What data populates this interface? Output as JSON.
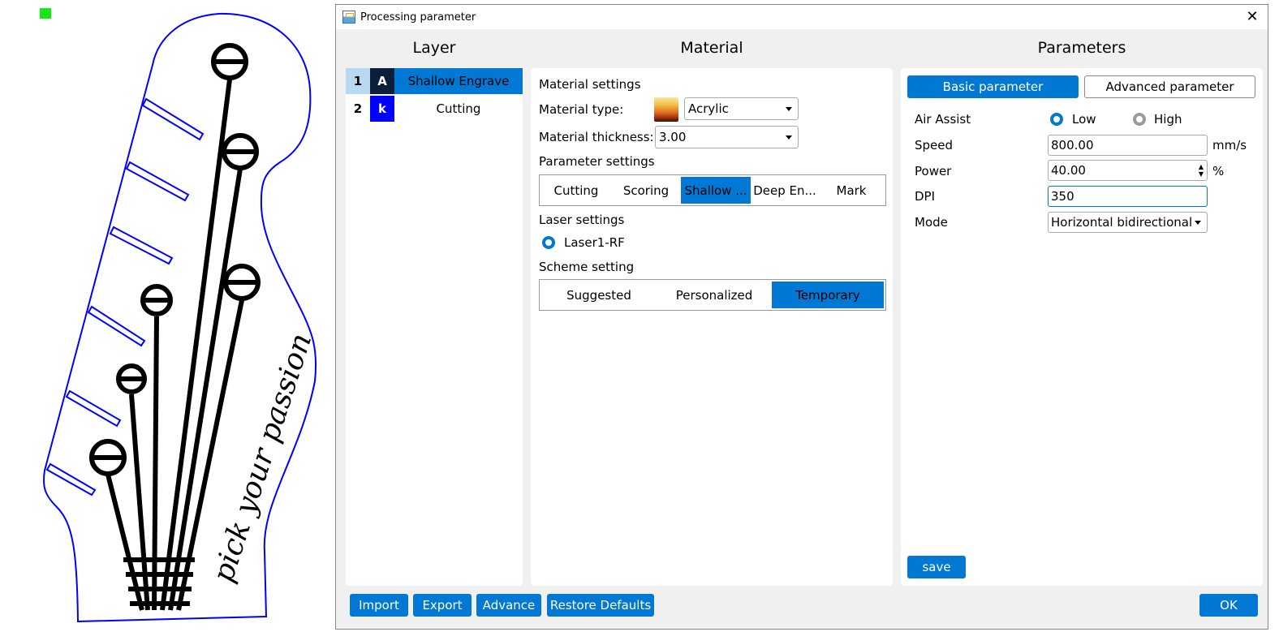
{
  "window": {
    "title": "Processing parameter",
    "close_glyph": "✕"
  },
  "columns": {
    "layer": "Layer",
    "material": "Material",
    "parameters": "Parameters"
  },
  "layers": [
    {
      "num": "1",
      "code": "A",
      "name": "Shallow Engrave",
      "color": "#0d1e3a",
      "selected": true
    },
    {
      "num": "2",
      "code": "k",
      "name": "Cutting",
      "color": "#0000ff",
      "selected": false
    }
  ],
  "material": {
    "section_title": "Material settings",
    "type_label": "Material type:",
    "type_value": "Acrylic",
    "thickness_label": "Material thickness:",
    "thickness_value": "3.00",
    "param_title": "Parameter settings",
    "param_tabs": [
      "Cutting",
      "Scoring",
      "Shallow ...",
      "Deep En...",
      "Mark"
    ],
    "param_active": "Shallow ...",
    "laser_title": "Laser settings",
    "laser_option": "Laser1-RF",
    "scheme_title": "Scheme setting",
    "scheme_tabs": [
      "Suggested",
      "Personalized",
      "Temporary"
    ],
    "scheme_active": "Temporary"
  },
  "params": {
    "tab_basic": "Basic parameter",
    "tab_advanced": "Advanced parameter",
    "air_assist_label": "Air Assist",
    "air_low": "Low",
    "air_high": "High",
    "speed_label": "Speed",
    "speed_value": "800.00",
    "speed_unit": "mm/s",
    "power_label": "Power",
    "power_value": "40.00",
    "power_unit": "%",
    "dpi_label": "DPI",
    "dpi_value": "350",
    "mode_label": "Mode",
    "mode_value": "Horizontal bidirectional",
    "save": "save"
  },
  "footer": {
    "import": "Import",
    "export": "Export",
    "advance": "Advance",
    "restore": "Restore Defaults",
    "ok": "OK"
  },
  "canvas": {
    "engraved_text": "pick your passion",
    "cut_color": "#0000ff",
    "engrave_color": "#000000",
    "marker_color": "#19e619"
  }
}
